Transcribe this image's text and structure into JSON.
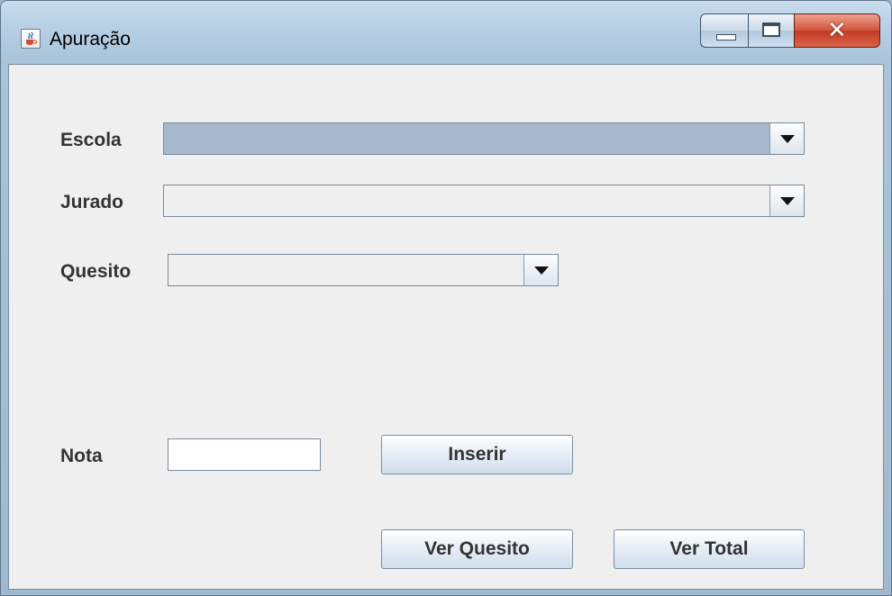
{
  "window": {
    "title": "Apuração",
    "app_icon": "java-cup-icon",
    "controls": {
      "minimize_icon": "minimize-icon",
      "maximize_icon": "maximize-icon",
      "close_icon": "close-icon"
    }
  },
  "form": {
    "escola_label": "Escola",
    "escola_value": "",
    "jurado_label": "Jurado",
    "jurado_value": "",
    "quesito_label": "Quesito",
    "quesito_value": "",
    "nota_label": "Nota",
    "nota_value": ""
  },
  "buttons": {
    "inserir": "Inserir",
    "ver_quesito": "Ver Quesito",
    "ver_total": "Ver Total"
  },
  "colors": {
    "content_bg": "#efefef",
    "selected_combo": "#a7b7cc",
    "close_red": "#c23a22"
  }
}
